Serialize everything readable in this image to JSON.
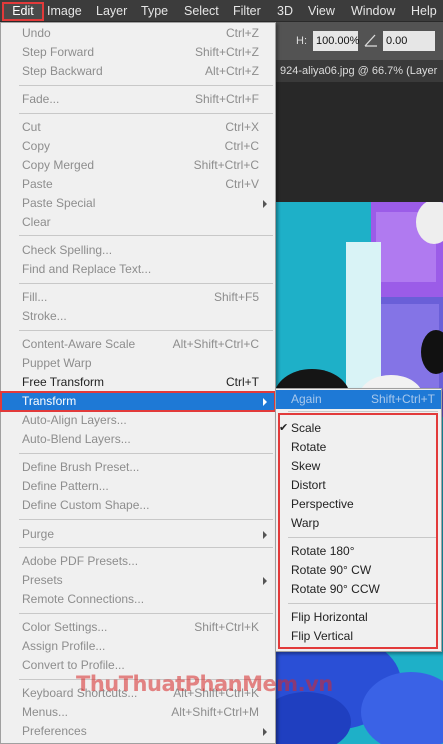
{
  "menubar": {
    "items": [
      "Edit",
      "Image",
      "Layer",
      "Type",
      "Select",
      "Filter",
      "3D",
      "View",
      "Window",
      "Help"
    ]
  },
  "options_bar": {
    "h_label": "H:",
    "h_value": "100.00%",
    "angle_value": "0.00"
  },
  "document_tab": "924-aliya06.jpg @ 66.7% (Layer",
  "edit_menu": {
    "items": [
      {
        "label": "Undo",
        "shortcut": "Ctrl+Z"
      },
      {
        "label": "Step Forward",
        "shortcut": "Shift+Ctrl+Z"
      },
      {
        "label": "Step Backward",
        "shortcut": "Alt+Ctrl+Z"
      },
      {
        "label": "Fade...",
        "shortcut": "Shift+Ctrl+F"
      },
      {
        "label": "Cut",
        "shortcut": "Ctrl+X"
      },
      {
        "label": "Copy",
        "shortcut": "Ctrl+C"
      },
      {
        "label": "Copy Merged",
        "shortcut": "Shift+Ctrl+C"
      },
      {
        "label": "Paste",
        "shortcut": "Ctrl+V"
      },
      {
        "label": "Paste Special",
        "shortcut": ""
      },
      {
        "label": "Clear",
        "shortcut": ""
      },
      {
        "label": "Check Spelling...",
        "shortcut": ""
      },
      {
        "label": "Find and Replace Text...",
        "shortcut": ""
      },
      {
        "label": "Fill...",
        "shortcut": "Shift+F5"
      },
      {
        "label": "Stroke...",
        "shortcut": ""
      },
      {
        "label": "Content-Aware Scale",
        "shortcut": "Alt+Shift+Ctrl+C"
      },
      {
        "label": "Puppet Warp",
        "shortcut": ""
      },
      {
        "label": "Free Transform",
        "shortcut": "Ctrl+T"
      },
      {
        "label": "Transform",
        "shortcut": ""
      },
      {
        "label": "Auto-Align Layers...",
        "shortcut": ""
      },
      {
        "label": "Auto-Blend Layers...",
        "shortcut": ""
      },
      {
        "label": "Define Brush Preset...",
        "shortcut": ""
      },
      {
        "label": "Define Pattern...",
        "shortcut": ""
      },
      {
        "label": "Define Custom Shape...",
        "shortcut": ""
      },
      {
        "label": "Purge",
        "shortcut": ""
      },
      {
        "label": "Adobe PDF Presets...",
        "shortcut": ""
      },
      {
        "label": "Presets",
        "shortcut": ""
      },
      {
        "label": "Remote Connections...",
        "shortcut": ""
      },
      {
        "label": "Color Settings...",
        "shortcut": "Shift+Ctrl+K"
      },
      {
        "label": "Assign Profile...",
        "shortcut": ""
      },
      {
        "label": "Convert to Profile...",
        "shortcut": ""
      },
      {
        "label": "Keyboard Shortcuts...",
        "shortcut": "Alt+Shift+Ctrl+K"
      },
      {
        "label": "Menus...",
        "shortcut": "Alt+Shift+Ctrl+M"
      },
      {
        "label": "Preferences",
        "shortcut": ""
      }
    ]
  },
  "transform_submenu": {
    "items": [
      {
        "label": "Again",
        "shortcut": "Shift+Ctrl+T"
      },
      {
        "label": "Scale",
        "shortcut": ""
      },
      {
        "label": "Rotate",
        "shortcut": ""
      },
      {
        "label": "Skew",
        "shortcut": ""
      },
      {
        "label": "Distort",
        "shortcut": ""
      },
      {
        "label": "Perspective",
        "shortcut": ""
      },
      {
        "label": "Warp",
        "shortcut": ""
      },
      {
        "label": "Rotate 180°",
        "shortcut": ""
      },
      {
        "label": "Rotate 90° CW",
        "shortcut": ""
      },
      {
        "label": "Rotate 90° CCW",
        "shortcut": ""
      },
      {
        "label": "Flip Horizontal",
        "shortcut": ""
      },
      {
        "label": "Flip Vertical",
        "shortcut": ""
      }
    ],
    "checked_label": "Scale"
  },
  "watermark": "ThuThuatPhanMem.vn",
  "colors": {
    "highlight": "#1e79d6",
    "annotation_red": "#e23a3a",
    "menu_bg": "#f0f0f0",
    "canvas_bg": "#1eb0c8"
  }
}
